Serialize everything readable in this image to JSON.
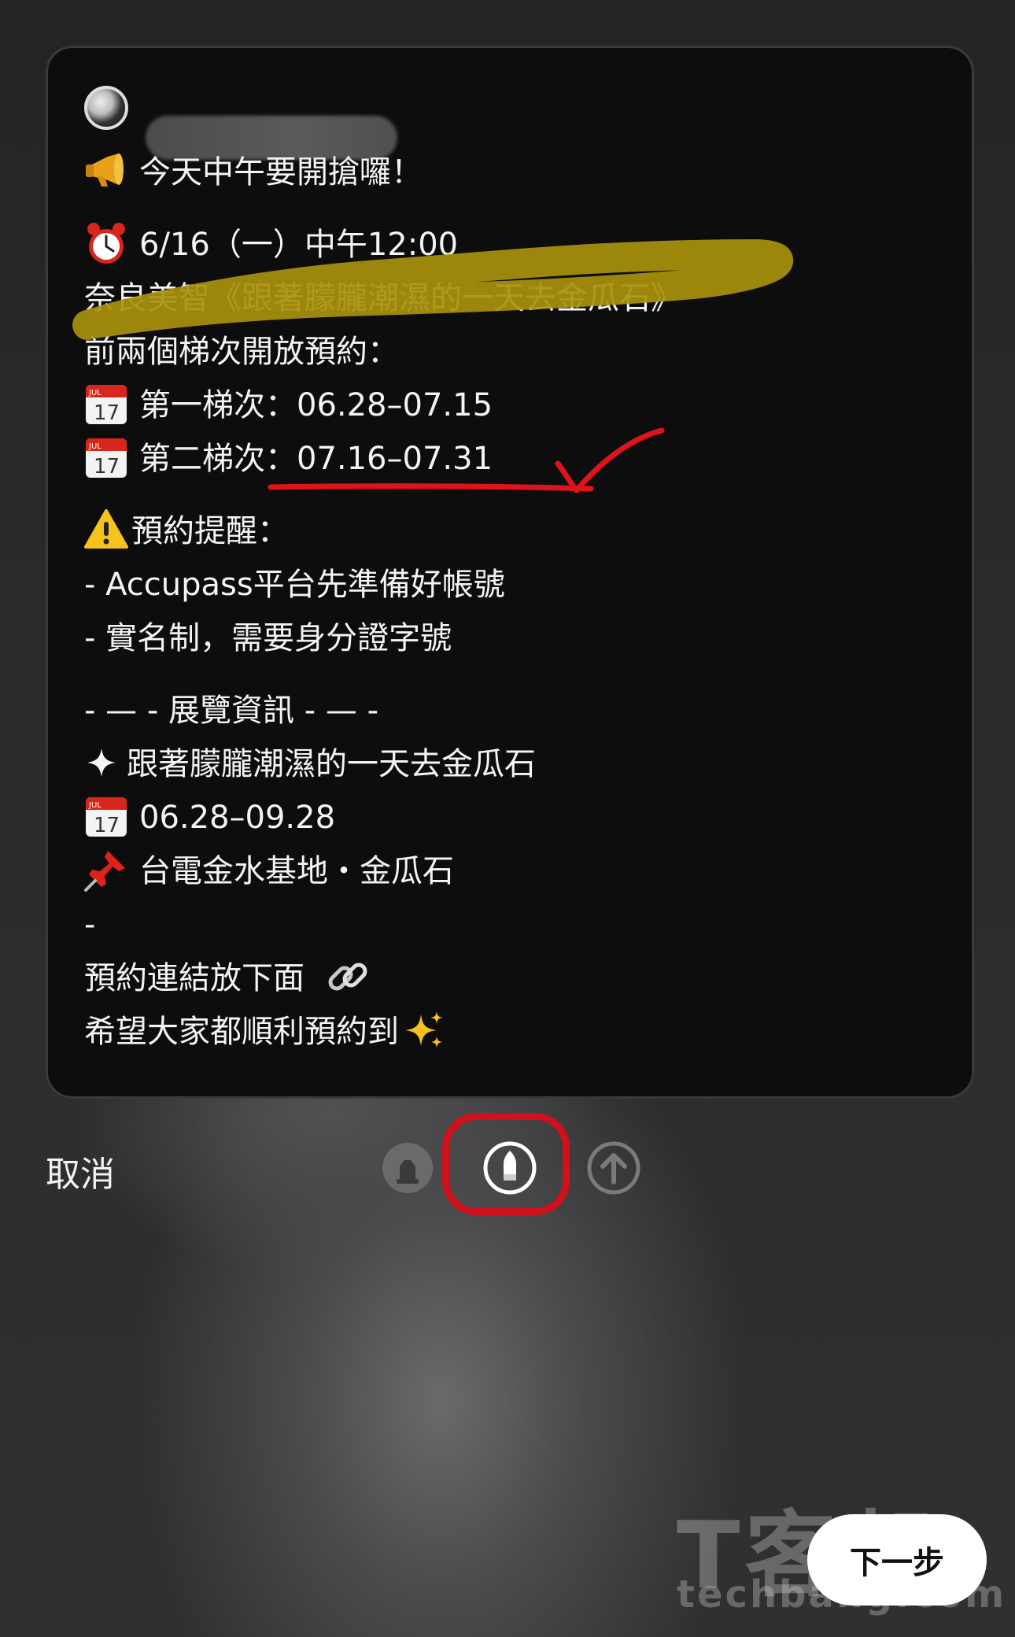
{
  "post": {
    "lines": [
      {
        "icon": "megaphone-icon",
        "text": "今天中午要開搶囉！"
      },
      {
        "icon": "alarm-clock-icon",
        "text": "6/16（一）中午12:00"
      },
      {
        "icon": "",
        "text": "奈良美智《跟著朦朧潮濕的一天去金瓜石》"
      },
      {
        "icon": "",
        "text": "前兩個梯次開放預約："
      },
      {
        "icon": "calendar-icon",
        "text": "第一梯次：06.28–07.15"
      },
      {
        "icon": "calendar-icon",
        "text": "第二梯次：07.16–07.31"
      },
      {
        "icon": "warning-icon",
        "text": "預約提醒："
      },
      {
        "icon": "",
        "text": "- Accupass平台先準備好帳號"
      },
      {
        "icon": "",
        "text": "- 實名制，需要身分證字號"
      },
      {
        "icon": "",
        "text": "- — - 展覽資訊 - — -"
      },
      {
        "icon": "sparkle-star-icon",
        "text": "跟著朦朧潮濕的一天去金瓜石"
      },
      {
        "icon": "calendar-icon",
        "text": "06.28–09.28"
      },
      {
        "icon": "pushpin-icon",
        "text": "台電金水基地・金瓜石"
      },
      {
        "icon": "",
        "text": "-"
      },
      {
        "icon": "",
        "text": "預約連結放下面",
        "trail_icon": "link-icon"
      },
      {
        "icon": "",
        "text": "希望大家都順利預約到",
        "trail_icon": "sparkles-icon"
      }
    ],
    "calendar_month": "JUL",
    "calendar_day": "17"
  },
  "toolbar": {
    "cancel_label": "取消",
    "tools": [
      "highlighter-icon",
      "pen-icon",
      "upload-arrow-icon"
    ],
    "selected_tool": "pen-icon"
  },
  "next_button": {
    "label": "下一步"
  },
  "watermark": {
    "logo": "T客邦",
    "domain": "techbang.com"
  },
  "colors": {
    "highlight_stroke": "#a8900c",
    "underline": "#e0121c",
    "checkmark": "#e0121c",
    "selection_ring": "#d0101a"
  }
}
